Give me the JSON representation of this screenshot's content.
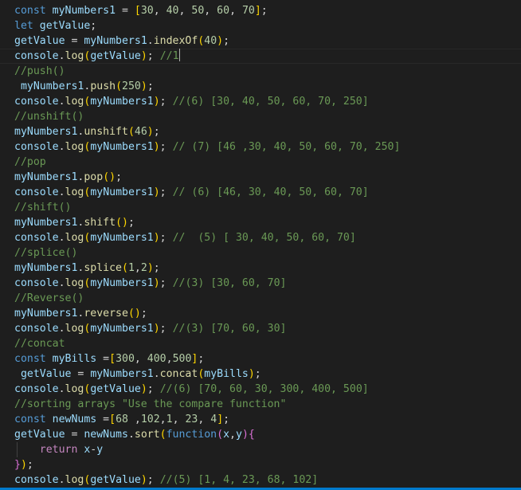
{
  "editor": {
    "lines": [
      [
        [
          "kw",
          "const "
        ],
        [
          "var",
          "myNumbers1"
        ],
        [
          "pun",
          " = "
        ],
        [
          "b1",
          "["
        ],
        [
          "num",
          "30"
        ],
        [
          "pun",
          ", "
        ],
        [
          "num",
          "40"
        ],
        [
          "pun",
          ", "
        ],
        [
          "num",
          "50"
        ],
        [
          "pun",
          ", "
        ],
        [
          "num",
          "60"
        ],
        [
          "pun",
          ", "
        ],
        [
          "num",
          "70"
        ],
        [
          "b1",
          "]"
        ],
        [
          "pun",
          ";"
        ]
      ],
      [
        [
          "kw",
          "let "
        ],
        [
          "var",
          "getValue"
        ],
        [
          "pun",
          ";"
        ]
      ],
      [
        [
          "var",
          "getValue"
        ],
        [
          "pun",
          " = "
        ],
        [
          "var",
          "myNumbers1"
        ],
        [
          "pun",
          "."
        ],
        [
          "fn",
          "indexOf"
        ],
        [
          "b1",
          "("
        ],
        [
          "num",
          "40"
        ],
        [
          "b1",
          ")"
        ],
        [
          "pun",
          ";"
        ]
      ],
      [
        [
          "var",
          "console"
        ],
        [
          "pun",
          "."
        ],
        [
          "fn",
          "log"
        ],
        [
          "b1",
          "("
        ],
        [
          "var",
          "getValue"
        ],
        [
          "b1",
          ")"
        ],
        [
          "pun",
          "; "
        ],
        [
          "cm",
          "//1"
        ]
      ],
      [
        [
          "cm",
          "//push()"
        ]
      ],
      [
        [
          "pun",
          " "
        ],
        [
          "var",
          "myNumbers1"
        ],
        [
          "pun",
          "."
        ],
        [
          "fn",
          "push"
        ],
        [
          "b1",
          "("
        ],
        [
          "num",
          "250"
        ],
        [
          "b1",
          ")"
        ],
        [
          "pun",
          ";"
        ]
      ],
      [
        [
          "var",
          "console"
        ],
        [
          "pun",
          "."
        ],
        [
          "fn",
          "log"
        ],
        [
          "b1",
          "("
        ],
        [
          "var",
          "myNumbers1"
        ],
        [
          "b1",
          ")"
        ],
        [
          "pun",
          "; "
        ],
        [
          "cm",
          "//(6) [30, 40, 50, 60, 70, 250]"
        ]
      ],
      [
        [
          "cm",
          "//unshift()"
        ]
      ],
      [
        [
          "var",
          "myNumbers1"
        ],
        [
          "pun",
          "."
        ],
        [
          "fn",
          "unshift"
        ],
        [
          "b1",
          "("
        ],
        [
          "num",
          "46"
        ],
        [
          "b1",
          ")"
        ],
        [
          "pun",
          ";"
        ]
      ],
      [
        [
          "var",
          "console"
        ],
        [
          "pun",
          "."
        ],
        [
          "fn",
          "log"
        ],
        [
          "b1",
          "("
        ],
        [
          "var",
          "myNumbers1"
        ],
        [
          "b1",
          ")"
        ],
        [
          "pun",
          "; "
        ],
        [
          "cm",
          "// (7) [46 ,30, 40, 50, 60, 70, 250]"
        ]
      ],
      [
        [
          "cm",
          "//pop"
        ]
      ],
      [
        [
          "var",
          "myNumbers1"
        ],
        [
          "pun",
          "."
        ],
        [
          "fn",
          "pop"
        ],
        [
          "b1",
          "()"
        ],
        [
          "pun",
          ";"
        ]
      ],
      [
        [
          "var",
          "console"
        ],
        [
          "pun",
          "."
        ],
        [
          "fn",
          "log"
        ],
        [
          "b1",
          "("
        ],
        [
          "var",
          "myNumbers1"
        ],
        [
          "b1",
          ")"
        ],
        [
          "pun",
          "; "
        ],
        [
          "cm",
          "// (6) [46, 30, 40, 50, 60, 70]"
        ]
      ],
      [
        [
          "cm",
          "//shift()"
        ]
      ],
      [
        [
          "var",
          "myNumbers1"
        ],
        [
          "pun",
          "."
        ],
        [
          "fn",
          "shift"
        ],
        [
          "b1",
          "()"
        ],
        [
          "pun",
          ";"
        ]
      ],
      [
        [
          "var",
          "console"
        ],
        [
          "pun",
          "."
        ],
        [
          "fn",
          "log"
        ],
        [
          "b1",
          "("
        ],
        [
          "var",
          "myNumbers1"
        ],
        [
          "b1",
          ")"
        ],
        [
          "pun",
          "; "
        ],
        [
          "cm",
          "//  (5) [ 30, 40, 50, 60, 70]"
        ]
      ],
      [
        [
          "cm",
          "//splice()"
        ]
      ],
      [
        [
          "var",
          "myNumbers1"
        ],
        [
          "pun",
          "."
        ],
        [
          "fn",
          "splice"
        ],
        [
          "b1",
          "("
        ],
        [
          "num",
          "1"
        ],
        [
          "pun",
          ","
        ],
        [
          "num",
          "2"
        ],
        [
          "b1",
          ")"
        ],
        [
          "pun",
          ";"
        ]
      ],
      [
        [
          "var",
          "console"
        ],
        [
          "pun",
          "."
        ],
        [
          "fn",
          "log"
        ],
        [
          "b1",
          "("
        ],
        [
          "var",
          "myNumbers1"
        ],
        [
          "b1",
          ")"
        ],
        [
          "pun",
          "; "
        ],
        [
          "cm",
          "//(3) [30, 60, 70]"
        ]
      ],
      [
        [
          "cm",
          "//Reverse()"
        ]
      ],
      [
        [
          "var",
          "myNumbers1"
        ],
        [
          "pun",
          "."
        ],
        [
          "fn",
          "reverse"
        ],
        [
          "b1",
          "()"
        ],
        [
          "pun",
          ";"
        ]
      ],
      [
        [
          "var",
          "console"
        ],
        [
          "pun",
          "."
        ],
        [
          "fn",
          "log"
        ],
        [
          "b1",
          "("
        ],
        [
          "var",
          "myNumbers1"
        ],
        [
          "b1",
          ")"
        ],
        [
          "pun",
          "; "
        ],
        [
          "cm",
          "//(3) [70, 60, 30]"
        ]
      ],
      [
        [
          "cm",
          "//concat"
        ]
      ],
      [
        [
          "kw",
          "const "
        ],
        [
          "var",
          "myBills"
        ],
        [
          "pun",
          " ="
        ],
        [
          "b1",
          "["
        ],
        [
          "num",
          "300"
        ],
        [
          "pun",
          ", "
        ],
        [
          "num",
          "400"
        ],
        [
          "pun",
          ","
        ],
        [
          "num",
          "500"
        ],
        [
          "b1",
          "]"
        ],
        [
          "pun",
          ";"
        ]
      ],
      [
        [
          "pun",
          " "
        ],
        [
          "var",
          "getValue"
        ],
        [
          "pun",
          " = "
        ],
        [
          "var",
          "myNumbers1"
        ],
        [
          "pun",
          "."
        ],
        [
          "fn",
          "concat"
        ],
        [
          "b1",
          "("
        ],
        [
          "var",
          "myBills"
        ],
        [
          "b1",
          ")"
        ],
        [
          "pun",
          ";"
        ]
      ],
      [
        [
          "var",
          "console"
        ],
        [
          "pun",
          "."
        ],
        [
          "fn",
          "log"
        ],
        [
          "b1",
          "("
        ],
        [
          "var",
          "getValue"
        ],
        [
          "b1",
          ")"
        ],
        [
          "pun",
          "; "
        ],
        [
          "cm",
          "//(6) [70, 60, 30, 300, 400, 500]"
        ]
      ],
      [
        [
          "cm",
          "//sorting arrays \"Use the compare function\""
        ]
      ],
      [
        [
          "kw",
          "const "
        ],
        [
          "var",
          "newNums"
        ],
        [
          "pun",
          " ="
        ],
        [
          "b1",
          "["
        ],
        [
          "num",
          "68"
        ],
        [
          "pun",
          " ,"
        ],
        [
          "num",
          "102"
        ],
        [
          "pun",
          ","
        ],
        [
          "num",
          "1"
        ],
        [
          "pun",
          ", "
        ],
        [
          "num",
          "23"
        ],
        [
          "pun",
          ", "
        ],
        [
          "num",
          "4"
        ],
        [
          "b1",
          "]"
        ],
        [
          "pun",
          ";"
        ]
      ],
      [
        [
          "var",
          "getValue"
        ],
        [
          "pun",
          " = "
        ],
        [
          "var",
          "newNums"
        ],
        [
          "pun",
          "."
        ],
        [
          "fn",
          "sort"
        ],
        [
          "b1",
          "("
        ],
        [
          "kw",
          "function"
        ],
        [
          "b2",
          "("
        ],
        [
          "var",
          "x"
        ],
        [
          "pun",
          ","
        ],
        [
          "var",
          "y"
        ],
        [
          "b2",
          ")"
        ],
        [
          "b2",
          "{"
        ]
      ],
      [
        [
          "pun",
          "    "
        ],
        [
          "ctl",
          "return "
        ],
        [
          "var",
          "x"
        ],
        [
          "pun",
          "-"
        ],
        [
          "var",
          "y"
        ]
      ],
      [
        [
          "b2",
          "}"
        ],
        [
          "b1",
          ")"
        ],
        [
          "pun",
          ";"
        ]
      ],
      [
        [
          "var",
          "console"
        ],
        [
          "pun",
          "."
        ],
        [
          "fn",
          "log"
        ],
        [
          "b1",
          "("
        ],
        [
          "var",
          "getValue"
        ],
        [
          "b1",
          ")"
        ],
        [
          "pun",
          "; "
        ],
        [
          "cm",
          "//(5) [1, 4, 23, 68, 102]"
        ]
      ]
    ],
    "cursor_line": 3
  }
}
